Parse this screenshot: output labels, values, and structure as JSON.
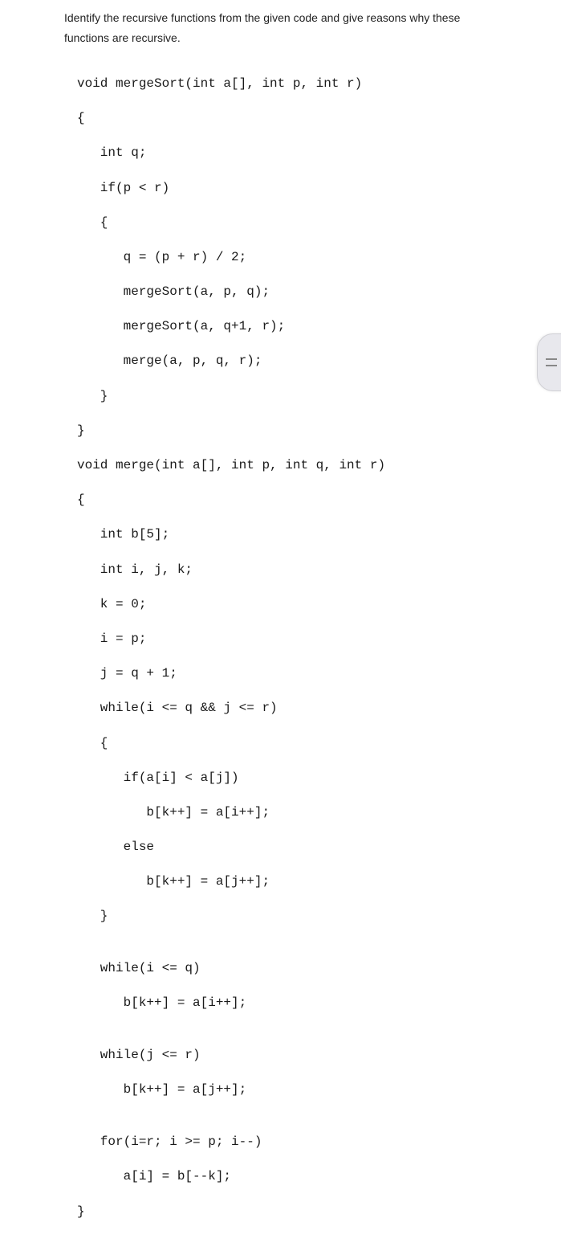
{
  "question": {
    "line1": "Identify the recursive functions from the given code and give reasons why these",
    "line2": "functions are recursive."
  },
  "code": {
    "l1": "void mergeSort(int a[], int p, int r)",
    "l2": "{",
    "l3": "   int q;",
    "l4": "   if(p < r)",
    "l5": "   {",
    "l6": "      q = (p + r) / 2;",
    "l7": "      mergeSort(a, p, q);",
    "l8": "      mergeSort(a, q+1, r);",
    "l9": "      merge(a, p, q, r);",
    "l10": "   }",
    "l11": "}",
    "l12": "void merge(int a[], int p, int q, int r)",
    "l13": "{",
    "l14": "   int b[5];",
    "l15": "   int i, j, k;",
    "l16": "   k = 0;",
    "l17": "   i = p;",
    "l18": "   j = q + 1;",
    "l19": "   while(i <= q && j <= r)",
    "l20": "   {",
    "l21": "      if(a[i] < a[j])",
    "l22": "         b[k++] = a[i++];",
    "l23": "      else",
    "l24": "         b[k++] = a[j++];",
    "l25": "   }",
    "l26": "",
    "l27": "   while(i <= q)",
    "l28": "      b[k++] = a[i++];",
    "l29": "",
    "l30": "   while(j <= r)",
    "l31": "      b[k++] = a[j++];",
    "l32": "",
    "l33": "   for(i=r; i >= p; i--)",
    "l34": "      a[i] = b[--k];",
    "l35": "}"
  }
}
